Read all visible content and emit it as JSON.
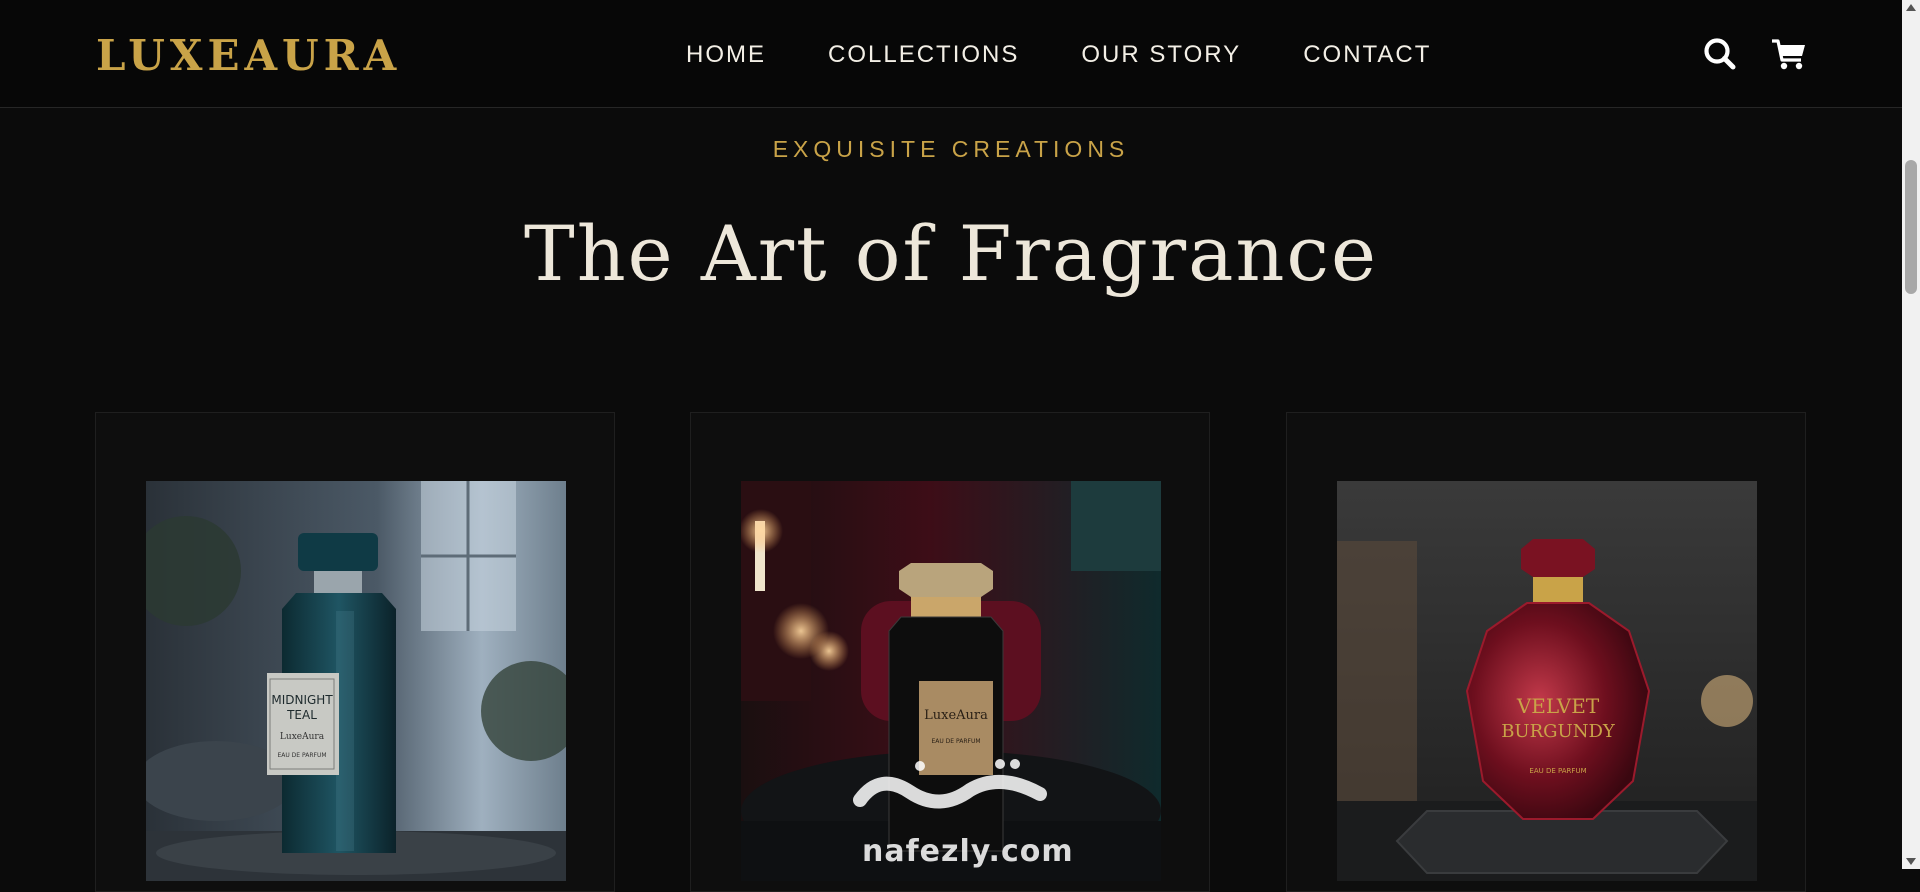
{
  "brand": {
    "logo": "LUXEAURA",
    "accent": "#c9a348"
  },
  "nav": {
    "items": [
      {
        "label": "HOME"
      },
      {
        "label": "COLLECTIONS"
      },
      {
        "label": "OUR STORY"
      },
      {
        "label": "CONTACT"
      }
    ],
    "icons": [
      "search-icon",
      "cart-icon"
    ]
  },
  "section": {
    "eyebrow": "EXQUISITE CREATIONS",
    "title": "The Art of Fragrance"
  },
  "products": [
    {
      "label_lines": [
        "MIDNIGHT",
        "TEAL"
      ],
      "brand": "LuxeAura",
      "type": "EAU DE PARFUM"
    },
    {
      "label_lines": [
        "LuxeAura"
      ],
      "type": "EAU DE PARFUM"
    },
    {
      "label_lines": [
        "VELVET",
        "BURGUNDY"
      ],
      "type": "EAU DE PARFUM"
    }
  ],
  "watermark": {
    "site": "nafezly.com"
  }
}
